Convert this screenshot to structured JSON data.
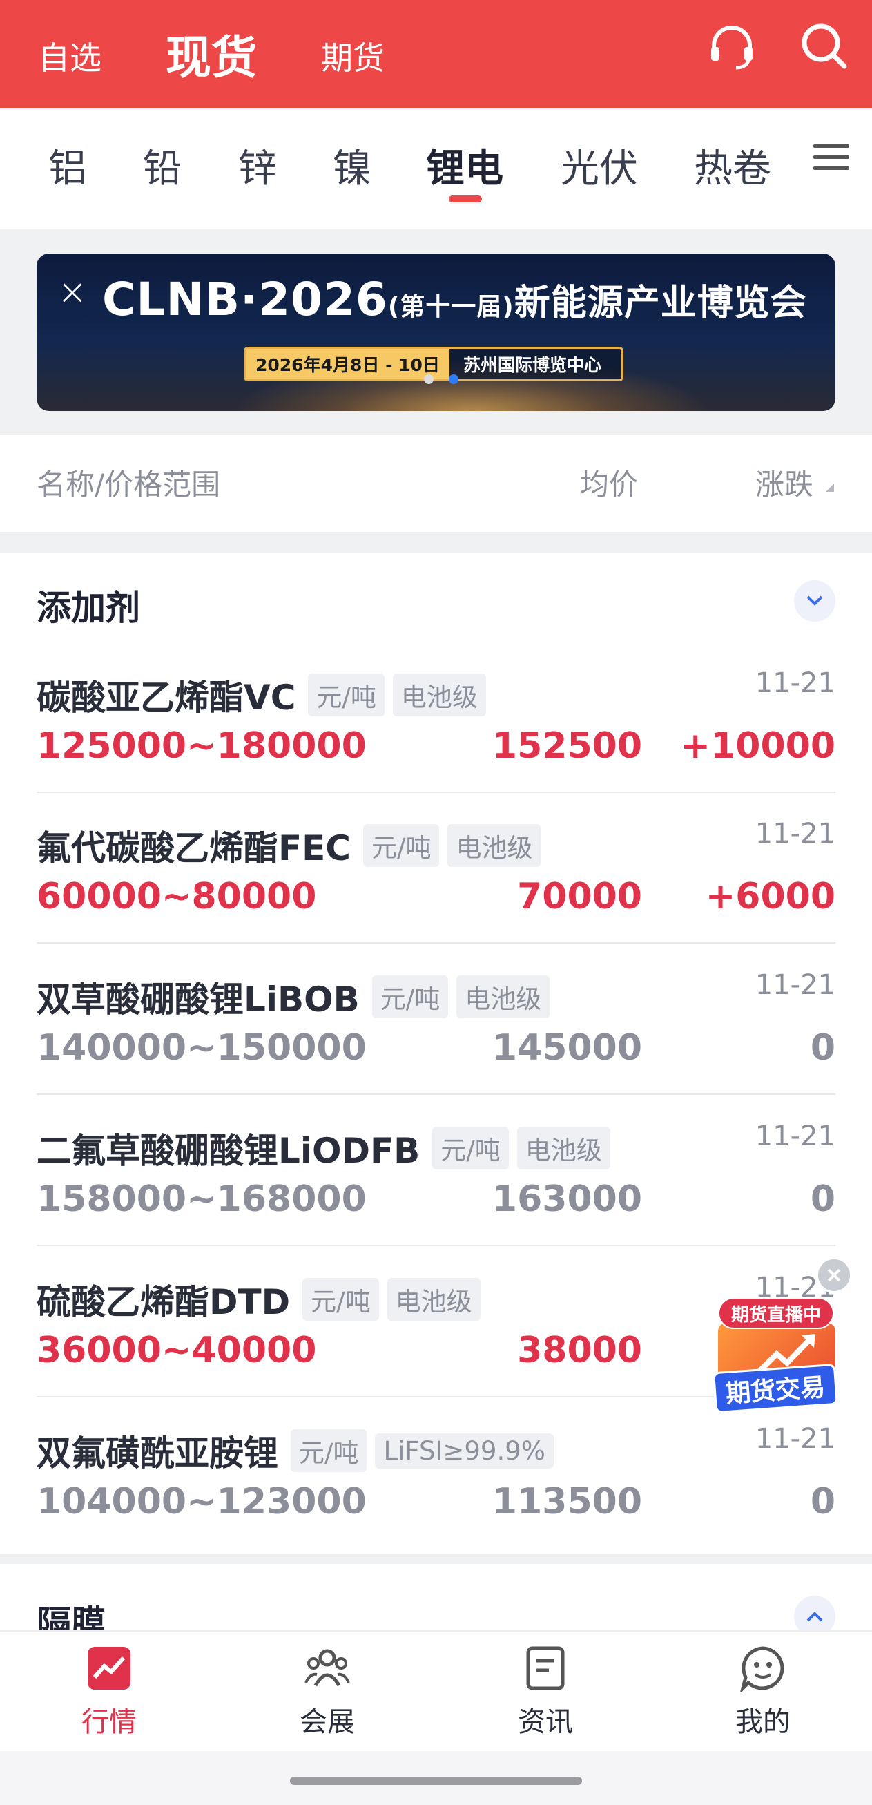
{
  "header": {
    "tab_zixuan": "自选",
    "tab_xianhuo": "现货",
    "tab_qihuo": "期货",
    "accent_color": "#ee4747"
  },
  "categories": [
    "铝",
    "铅",
    "锌",
    "镍",
    "锂电",
    "光伏",
    "热卷"
  ],
  "active_category": "锂电",
  "banner": {
    "title_main": "CLNB·2026",
    "title_edition": "(第十一届)",
    "title_cn": "新能源产业博览会",
    "date": "2026年4月8日 - 10日",
    "venue": "苏州国际博览中心"
  },
  "columns": {
    "name": "名称/价格范围",
    "avg": "均价",
    "change": "涨跌"
  },
  "section1": {
    "title": "添加剂",
    "rows": [
      {
        "name": "碳酸亚乙烯酯VC",
        "unit": "元/吨",
        "grade": "电池级",
        "date": "11-21",
        "range": "125000~180000",
        "avg": "152500",
        "change": "+10000",
        "trend": "up"
      },
      {
        "name": "氟代碳酸乙烯酯FEC",
        "unit": "元/吨",
        "grade": "电池级",
        "date": "11-21",
        "range": "60000~80000",
        "avg": "70000",
        "change": "+6000",
        "trend": "up"
      },
      {
        "name": "双草酸硼酸锂LiBOB",
        "unit": "元/吨",
        "grade": "电池级",
        "date": "11-21",
        "range": "140000~150000",
        "avg": "145000",
        "change": "0",
        "trend": "flat"
      },
      {
        "name": "二氟草酸硼酸锂LiODFB",
        "unit": "元/吨",
        "grade": "电池级",
        "date": "11-21",
        "range": "158000~168000",
        "avg": "163000",
        "change": "0",
        "trend": "flat"
      },
      {
        "name": "硫酸乙烯酯DTD",
        "unit": "元/吨",
        "grade": "电池级",
        "date": "11-21",
        "range": "36000~40000",
        "avg": "38000",
        "change": "",
        "trend": "up"
      },
      {
        "name": "双氟磺酰亚胺锂",
        "unit": "元/吨",
        "grade": "LiFSI≥99.9%",
        "date": "11-21",
        "range": "104000~123000",
        "avg": "113500",
        "change": "0",
        "trend": "flat"
      }
    ]
  },
  "section2": {
    "title": "隔膜"
  },
  "float_ad": {
    "badge": "期货直播中",
    "label": "期货交易"
  },
  "bottom_nav": {
    "items": [
      "行情",
      "会展",
      "资讯",
      "我的"
    ],
    "active": "行情"
  }
}
